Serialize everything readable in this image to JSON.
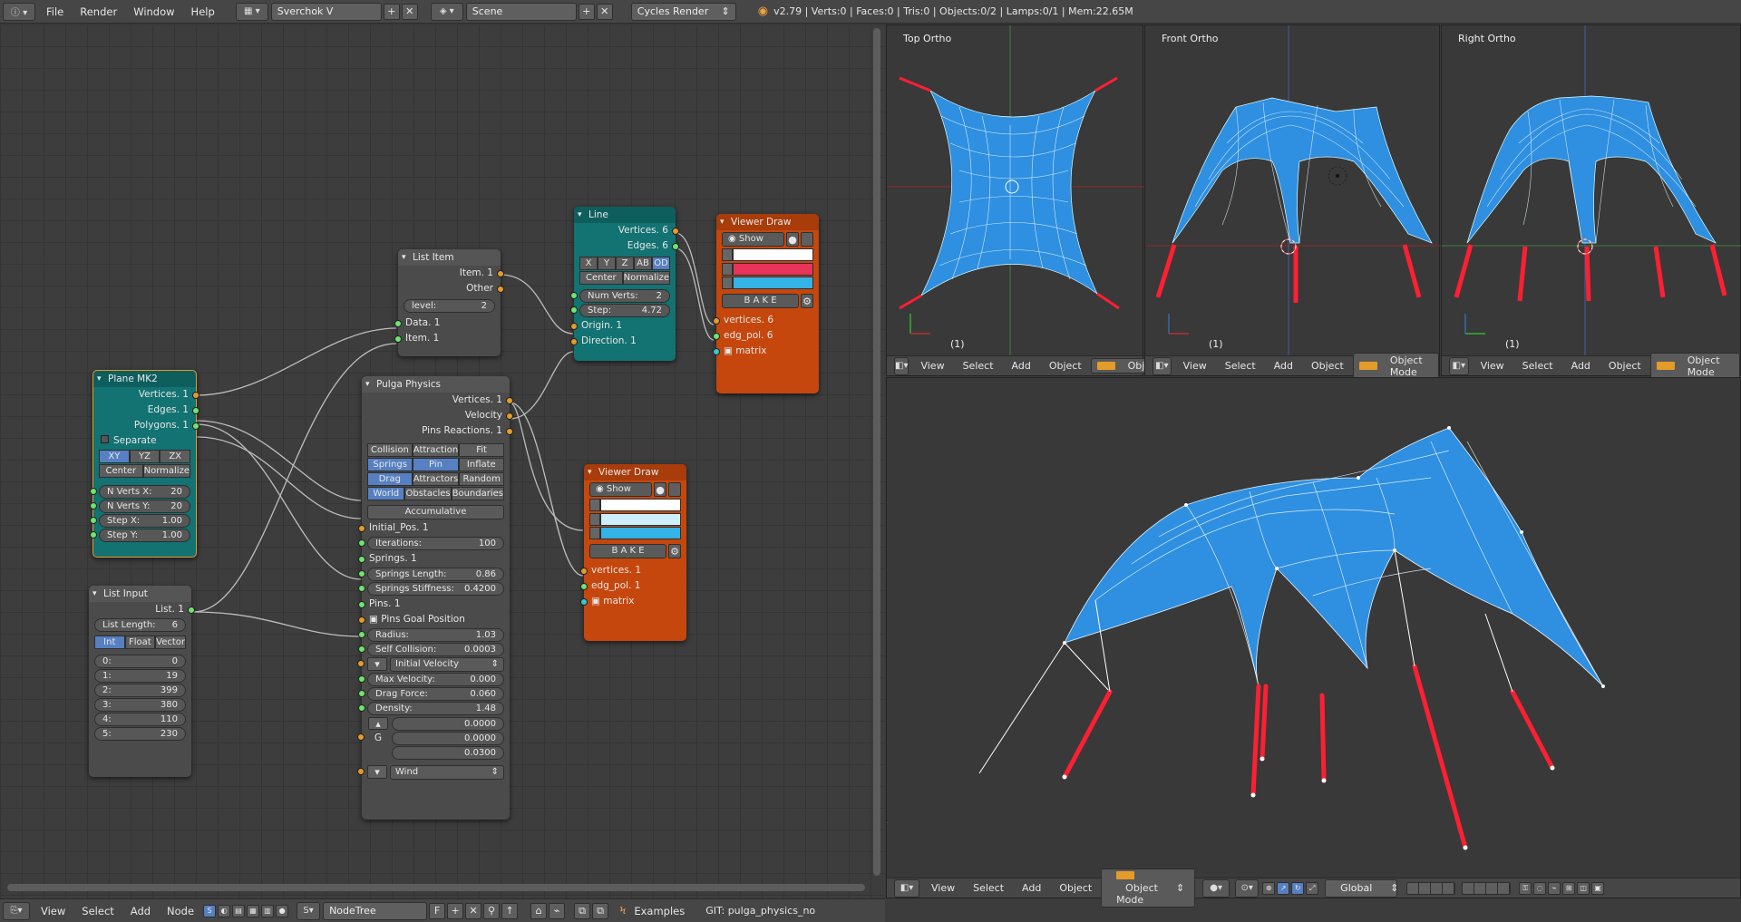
{
  "topbar": {
    "menus": [
      "File",
      "Render",
      "Window",
      "Help"
    ],
    "screen": "Sverchok V",
    "scene": "Scene",
    "engine": "Cycles Render",
    "stats": "v2.79 | Verts:0 | Faces:0 | Tris:0 | Objects:0/2 | Lamps:0/1 | Mem:22.65M"
  },
  "nodes": {
    "plane": {
      "title": "Plane MK2",
      "outs": [
        "Vertices. 1",
        "Edges. 1",
        "Polygons. 1"
      ],
      "separate": "Separate",
      "axes": [
        "XY",
        "YZ",
        "ZX"
      ],
      "opts": [
        "Center",
        "Normalize"
      ],
      "fields": [
        {
          "k": "N Verts X:",
          "v": "20"
        },
        {
          "k": "N Verts Y:",
          "v": "20"
        },
        {
          "k": "Step X:",
          "v": "1.00"
        },
        {
          "k": "Step Y:",
          "v": "1.00"
        }
      ]
    },
    "listinput": {
      "title": "List Input",
      "out": "List. 1",
      "length_k": "List Length:",
      "length_v": "6",
      "modes": [
        "Int",
        "Float",
        "Vector"
      ],
      "items": [
        {
          "k": "0:",
          "v": "0"
        },
        {
          "k": "1:",
          "v": "19"
        },
        {
          "k": "2:",
          "v": "399"
        },
        {
          "k": "3:",
          "v": "380"
        },
        {
          "k": "4:",
          "v": "110"
        },
        {
          "k": "5:",
          "v": "230"
        }
      ]
    },
    "listitem": {
      "title": "List Item",
      "outs": [
        "Item. 1",
        "Other"
      ],
      "level_k": "level:",
      "level_v": "2",
      "ins": [
        "Data. 1",
        "Item. 1"
      ]
    },
    "line": {
      "title": "Line",
      "outs": [
        "Vertices. 6",
        "Edges. 6"
      ],
      "axes": [
        "X",
        "Y",
        "Z",
        "AB",
        "OD"
      ],
      "opts": [
        "Center",
        "Normalize"
      ],
      "fields": [
        {
          "k": "Num Verts:",
          "v": "2"
        },
        {
          "k": "Step:",
          "v": "4.72"
        }
      ],
      "ins": [
        "Origin. 1",
        "Direction. 1"
      ]
    },
    "viewer1": {
      "title": "Viewer Draw",
      "show": "Show",
      "bake": "B A K E",
      "ins": [
        "vertices. 6",
        "edg_pol. 6",
        "matrix"
      ]
    },
    "viewer2": {
      "title": "Viewer Draw",
      "show": "Show",
      "bake": "B A K E",
      "ins": [
        "vertices. 1",
        "edg_pol. 1",
        "matrix"
      ]
    },
    "pulga": {
      "title": "Pulga Physics",
      "outs": [
        "Vertices. 1",
        "Velocity",
        "Pins Reactions. 1"
      ],
      "grid": [
        [
          "Collision",
          "Attraction",
          "Fit"
        ],
        [
          "Springs",
          "Pin",
          "Inflate"
        ],
        [
          "Drag",
          "Attractors",
          "Random"
        ],
        [
          "World",
          "Obstacles",
          "Boundaries"
        ]
      ],
      "accum": "Accumulative",
      "ins1": [
        "Initial_Pos. 1"
      ],
      "iter_k": "Iterations:",
      "iter_v": "100",
      "springs": "Springs. 1",
      "sl_k": "Springs Length:",
      "sl_v": "0.86",
      "ss_k": "Springs Stiffness:",
      "ss_v": "0.4200",
      "pins": "Pins. 1",
      "pgp": "Pins Goal Position",
      "rad_k": "Radius:",
      "rad_v": "1.03",
      "sc_k": "Self Collision:",
      "sc_v": "0.0003",
      "iv": "Initial Velocity",
      "mv_k": "Max Velocity:",
      "mv_v": "0.000",
      "df_k": "Drag Force:",
      "df_v": "0.060",
      "de_k": "Density:",
      "de_v": "1.48",
      "g_label": "G",
      "g_vals": [
        "0.0000",
        "0.0000",
        "0.0300"
      ],
      "wind": "Wind"
    }
  },
  "viewports": {
    "top": "Top Ortho",
    "front": "Front Ortho",
    "right": "Right Ortho",
    "frame": "(1)",
    "menus": [
      "View",
      "Select",
      "Add",
      "Object"
    ],
    "mode": "Object Mode",
    "mode_short": "Objec",
    "orient": "Global"
  },
  "bottombar": {
    "menus": [
      "View",
      "Select",
      "Add",
      "Node"
    ],
    "tree": "NodeTree",
    "fake": "F",
    "examples": "Examples",
    "git": "GIT: pulga_physics_node"
  }
}
